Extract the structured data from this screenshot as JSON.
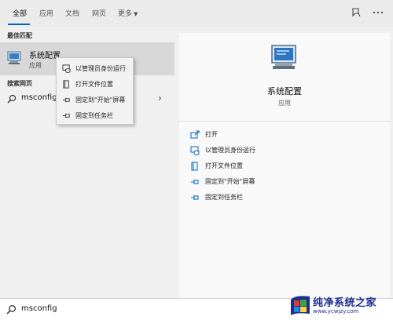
{
  "tabs": [
    {
      "label": "全部",
      "active": true
    },
    {
      "label": "应用"
    },
    {
      "label": "文档"
    },
    {
      "label": "网页"
    },
    {
      "label": "更多"
    }
  ],
  "top_icons": [
    "feedback-icon",
    "more-icon"
  ],
  "left": {
    "best_match_label": "最佳匹配",
    "best_match": {
      "title": "系统配置",
      "subtitle": "应用",
      "icon": "system-config-icon"
    },
    "web_search_label": "搜索网页",
    "web_result": {
      "text": "msconfig",
      "icon": "search-icon"
    }
  },
  "context_menu": [
    {
      "label": "以管理员身份运行",
      "icon": "run-as-admin-icon"
    },
    {
      "label": "打开文件位置",
      "icon": "file-location-icon"
    },
    {
      "label": "固定到\"开始\"屏幕",
      "icon": "pin-icon"
    },
    {
      "label": "固定到任务栏",
      "icon": "pin-icon"
    }
  ],
  "right": {
    "title": "系统配置",
    "subtitle": "应用",
    "actions": [
      {
        "label": "打开",
        "icon": "open-icon"
      },
      {
        "label": "以管理员身份运行",
        "icon": "run-as-admin-icon"
      },
      {
        "label": "打开文件位置",
        "icon": "file-location-icon"
      },
      {
        "label": "固定到\"开始\"屏幕",
        "icon": "pin-icon"
      },
      {
        "label": "固定到任务栏",
        "icon": "pin-icon"
      }
    ]
  },
  "search": {
    "value": "msconfig"
  },
  "watermark": {
    "title": "纯净系统之家",
    "url": "www.ycwjzy.com"
  },
  "colors": {
    "accent": "#0067c0",
    "selected_row": "#d7d7d7",
    "watermark": "#1b2f8c"
  }
}
